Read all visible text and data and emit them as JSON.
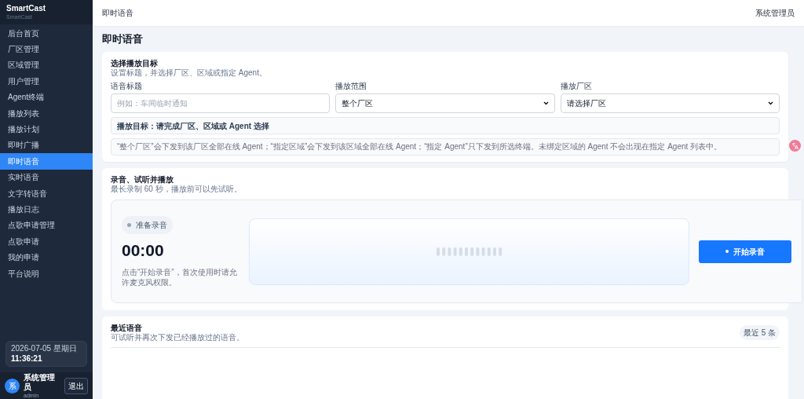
{
  "brand": {
    "name": "SmartCast",
    "subtitle": "SmartCast"
  },
  "sidebar": {
    "items": [
      {
        "label": "后台首页",
        "selected": false
      },
      {
        "label": "厂区管理",
        "selected": false
      },
      {
        "label": "区域管理",
        "selected": false
      },
      {
        "label": "用户管理",
        "selected": false
      },
      {
        "label": "Agent终端",
        "selected": false
      },
      {
        "label": "播放列表",
        "selected": false
      },
      {
        "label": "播放计划",
        "selected": false
      },
      {
        "label": "即时广播",
        "selected": false
      },
      {
        "label": "即时语音",
        "selected": true
      },
      {
        "label": "实时语音",
        "selected": false
      },
      {
        "label": "文字转语音",
        "selected": false
      },
      {
        "label": "播放日志",
        "selected": false
      },
      {
        "label": "点歌申请管理",
        "selected": false
      },
      {
        "label": "点歌申请",
        "selected": false
      },
      {
        "label": "我的申请",
        "selected": false
      },
      {
        "label": "平台说明",
        "selected": false
      }
    ],
    "clock": {
      "date": "2026-07-05 星期日",
      "time": "11:36:21"
    },
    "user": {
      "avatar": "系",
      "name": "系统管理员",
      "account": "admin",
      "logout": "退出"
    }
  },
  "header": {
    "breadcrumb": "即时语音",
    "user": "系统管理员"
  },
  "page_title": "即时语音",
  "target_card": {
    "title": "选择播放目标",
    "subtitle": "设置标题，并选择厂区、区域或指定 Agent。",
    "fields": [
      {
        "kind": "input",
        "label": "语音标题",
        "placeholder": "例如：车间临时通知"
      },
      {
        "kind": "select",
        "label": "播放范围",
        "value": "整个厂区"
      },
      {
        "kind": "select",
        "label": "播放厂区",
        "value": "请选择厂区"
      }
    ],
    "target_summary": "播放目标：请完成厂区、区域或 Agent 选择",
    "hint": "“整个厂区”会下发到该厂区全部在线 Agent；“指定区域”会下发到该区域全部在线 Agent；“指定 Agent”只下发到所选终端。未绑定区域的 Agent 不会出现在指定 Agent 列表中。"
  },
  "record_card": {
    "title": "录音、试听并播放",
    "subtitle": "最长录制 60 秒，播放前可以先试听。",
    "status": "准备录音",
    "timer": "00:00",
    "note": "点击“开始录音”，首次使用时请允许麦克风权限。",
    "button": "开始录音"
  },
  "recent_card": {
    "title": "最近语音",
    "subtitle": "可试听并再次下发已经播放过的语音。",
    "badge": "最近 5 条"
  }
}
